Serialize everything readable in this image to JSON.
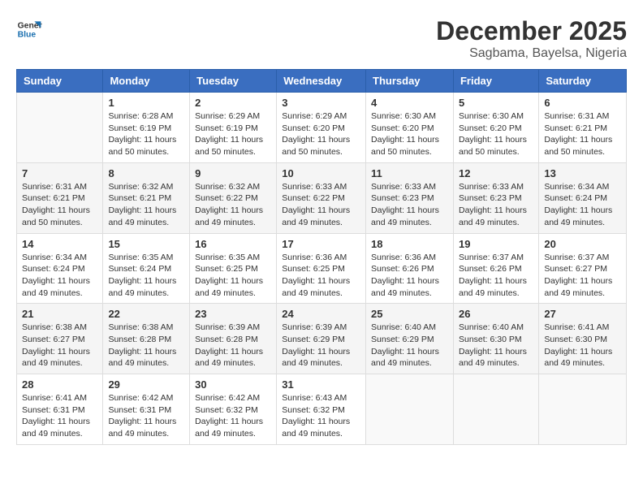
{
  "logo": {
    "line1": "General",
    "line2": "Blue"
  },
  "title": "December 2025",
  "location": "Sagbama, Bayelsa, Nigeria",
  "weekdays": [
    "Sunday",
    "Monday",
    "Tuesday",
    "Wednesday",
    "Thursday",
    "Friday",
    "Saturday"
  ],
  "weeks": [
    [
      {
        "day": "",
        "info": ""
      },
      {
        "day": "1",
        "info": "Sunrise: 6:28 AM\nSunset: 6:19 PM\nDaylight: 11 hours\nand 50 minutes."
      },
      {
        "day": "2",
        "info": "Sunrise: 6:29 AM\nSunset: 6:19 PM\nDaylight: 11 hours\nand 50 minutes."
      },
      {
        "day": "3",
        "info": "Sunrise: 6:29 AM\nSunset: 6:20 PM\nDaylight: 11 hours\nand 50 minutes."
      },
      {
        "day": "4",
        "info": "Sunrise: 6:30 AM\nSunset: 6:20 PM\nDaylight: 11 hours\nand 50 minutes."
      },
      {
        "day": "5",
        "info": "Sunrise: 6:30 AM\nSunset: 6:20 PM\nDaylight: 11 hours\nand 50 minutes."
      },
      {
        "day": "6",
        "info": "Sunrise: 6:31 AM\nSunset: 6:21 PM\nDaylight: 11 hours\nand 50 minutes."
      }
    ],
    [
      {
        "day": "7",
        "info": "Sunrise: 6:31 AM\nSunset: 6:21 PM\nDaylight: 11 hours\nand 50 minutes."
      },
      {
        "day": "8",
        "info": "Sunrise: 6:32 AM\nSunset: 6:21 PM\nDaylight: 11 hours\nand 49 minutes."
      },
      {
        "day": "9",
        "info": "Sunrise: 6:32 AM\nSunset: 6:22 PM\nDaylight: 11 hours\nand 49 minutes."
      },
      {
        "day": "10",
        "info": "Sunrise: 6:33 AM\nSunset: 6:22 PM\nDaylight: 11 hours\nand 49 minutes."
      },
      {
        "day": "11",
        "info": "Sunrise: 6:33 AM\nSunset: 6:23 PM\nDaylight: 11 hours\nand 49 minutes."
      },
      {
        "day": "12",
        "info": "Sunrise: 6:33 AM\nSunset: 6:23 PM\nDaylight: 11 hours\nand 49 minutes."
      },
      {
        "day": "13",
        "info": "Sunrise: 6:34 AM\nSunset: 6:24 PM\nDaylight: 11 hours\nand 49 minutes."
      }
    ],
    [
      {
        "day": "14",
        "info": "Sunrise: 6:34 AM\nSunset: 6:24 PM\nDaylight: 11 hours\nand 49 minutes."
      },
      {
        "day": "15",
        "info": "Sunrise: 6:35 AM\nSunset: 6:24 PM\nDaylight: 11 hours\nand 49 minutes."
      },
      {
        "day": "16",
        "info": "Sunrise: 6:35 AM\nSunset: 6:25 PM\nDaylight: 11 hours\nand 49 minutes."
      },
      {
        "day": "17",
        "info": "Sunrise: 6:36 AM\nSunset: 6:25 PM\nDaylight: 11 hours\nand 49 minutes."
      },
      {
        "day": "18",
        "info": "Sunrise: 6:36 AM\nSunset: 6:26 PM\nDaylight: 11 hours\nand 49 minutes."
      },
      {
        "day": "19",
        "info": "Sunrise: 6:37 AM\nSunset: 6:26 PM\nDaylight: 11 hours\nand 49 minutes."
      },
      {
        "day": "20",
        "info": "Sunrise: 6:37 AM\nSunset: 6:27 PM\nDaylight: 11 hours\nand 49 minutes."
      }
    ],
    [
      {
        "day": "21",
        "info": "Sunrise: 6:38 AM\nSunset: 6:27 PM\nDaylight: 11 hours\nand 49 minutes."
      },
      {
        "day": "22",
        "info": "Sunrise: 6:38 AM\nSunset: 6:28 PM\nDaylight: 11 hours\nand 49 minutes."
      },
      {
        "day": "23",
        "info": "Sunrise: 6:39 AM\nSunset: 6:28 PM\nDaylight: 11 hours\nand 49 minutes."
      },
      {
        "day": "24",
        "info": "Sunrise: 6:39 AM\nSunset: 6:29 PM\nDaylight: 11 hours\nand 49 minutes."
      },
      {
        "day": "25",
        "info": "Sunrise: 6:40 AM\nSunset: 6:29 PM\nDaylight: 11 hours\nand 49 minutes."
      },
      {
        "day": "26",
        "info": "Sunrise: 6:40 AM\nSunset: 6:30 PM\nDaylight: 11 hours\nand 49 minutes."
      },
      {
        "day": "27",
        "info": "Sunrise: 6:41 AM\nSunset: 6:30 PM\nDaylight: 11 hours\nand 49 minutes."
      }
    ],
    [
      {
        "day": "28",
        "info": "Sunrise: 6:41 AM\nSunset: 6:31 PM\nDaylight: 11 hours\nand 49 minutes."
      },
      {
        "day": "29",
        "info": "Sunrise: 6:42 AM\nSunset: 6:31 PM\nDaylight: 11 hours\nand 49 minutes."
      },
      {
        "day": "30",
        "info": "Sunrise: 6:42 AM\nSunset: 6:32 PM\nDaylight: 11 hours\nand 49 minutes."
      },
      {
        "day": "31",
        "info": "Sunrise: 6:43 AM\nSunset: 6:32 PM\nDaylight: 11 hours\nand 49 minutes."
      },
      {
        "day": "",
        "info": ""
      },
      {
        "day": "",
        "info": ""
      },
      {
        "day": "",
        "info": ""
      }
    ]
  ]
}
